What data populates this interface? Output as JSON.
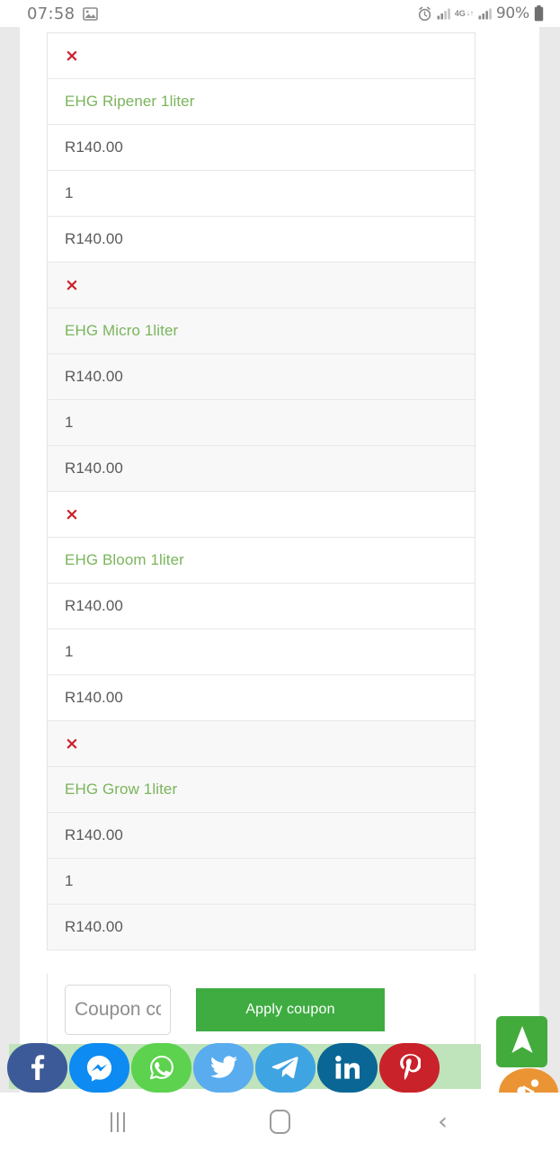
{
  "status_bar": {
    "time": "07:58",
    "gallery_icon": "image-icon",
    "alarm_icon": "alarm-icon",
    "signal_icon_1": "signal-bars-icon",
    "network_label": "4G",
    "network_arrows": "↓↑",
    "signal_icon_2": "signal-bars-icon",
    "battery_percent": "90%",
    "battery_icon": "battery-icon"
  },
  "cart": {
    "items": [
      {
        "remove_label": "×",
        "name": "EHG Ripener 1liter",
        "price": "R140.00",
        "quantity": "1",
        "subtotal": "R140.00"
      },
      {
        "remove_label": "×",
        "name": "EHG Micro 1liter",
        "price": "R140.00",
        "quantity": "1",
        "subtotal": "R140.00"
      },
      {
        "remove_label": "×",
        "name": "EHG Bloom 1liter",
        "price": "R140.00",
        "quantity": "1",
        "subtotal": "R140.00"
      },
      {
        "remove_label": "×",
        "name": "EHG Grow 1liter",
        "price": "R140.00",
        "quantity": "1",
        "subtotal": "R140.00"
      }
    ]
  },
  "coupon": {
    "placeholder": "Coupon code",
    "value": "",
    "apply_label": "Apply coupon"
  },
  "social_share": {
    "buttons": [
      {
        "name": "facebook",
        "icon": "facebook-icon",
        "color": "#3d5a98"
      },
      {
        "name": "messenger",
        "icon": "messenger-icon",
        "color": "#0d8bf2"
      },
      {
        "name": "whatsapp",
        "icon": "whatsapp-icon",
        "color": "#5cd24e"
      },
      {
        "name": "twitter",
        "icon": "twitter-icon",
        "color": "#59aced"
      },
      {
        "name": "telegram",
        "icon": "telegram-icon",
        "color": "#3fa4e2"
      },
      {
        "name": "linkedin",
        "icon": "linkedin-icon",
        "color": "#0a6694"
      },
      {
        "name": "pinterest",
        "icon": "pinterest-icon",
        "color": "#c9222a"
      }
    ]
  },
  "floating": {
    "scroll_top_icon": "navigation-arrow-up-icon",
    "scroll_top_color": "#43ab3c",
    "share_icon": "share-nodes-icon",
    "share_color": "#eb9434"
  },
  "android_nav": {
    "recents_label": "|||",
    "home_label": "O",
    "back_label": "‹"
  },
  "theme": {
    "link_green": "#7ab55c",
    "button_green": "#3fac42",
    "remove_red": "#cc1f28",
    "row_alt_bg": "#f8f8f8",
    "gutter_grey": "#e9e9e9"
  }
}
